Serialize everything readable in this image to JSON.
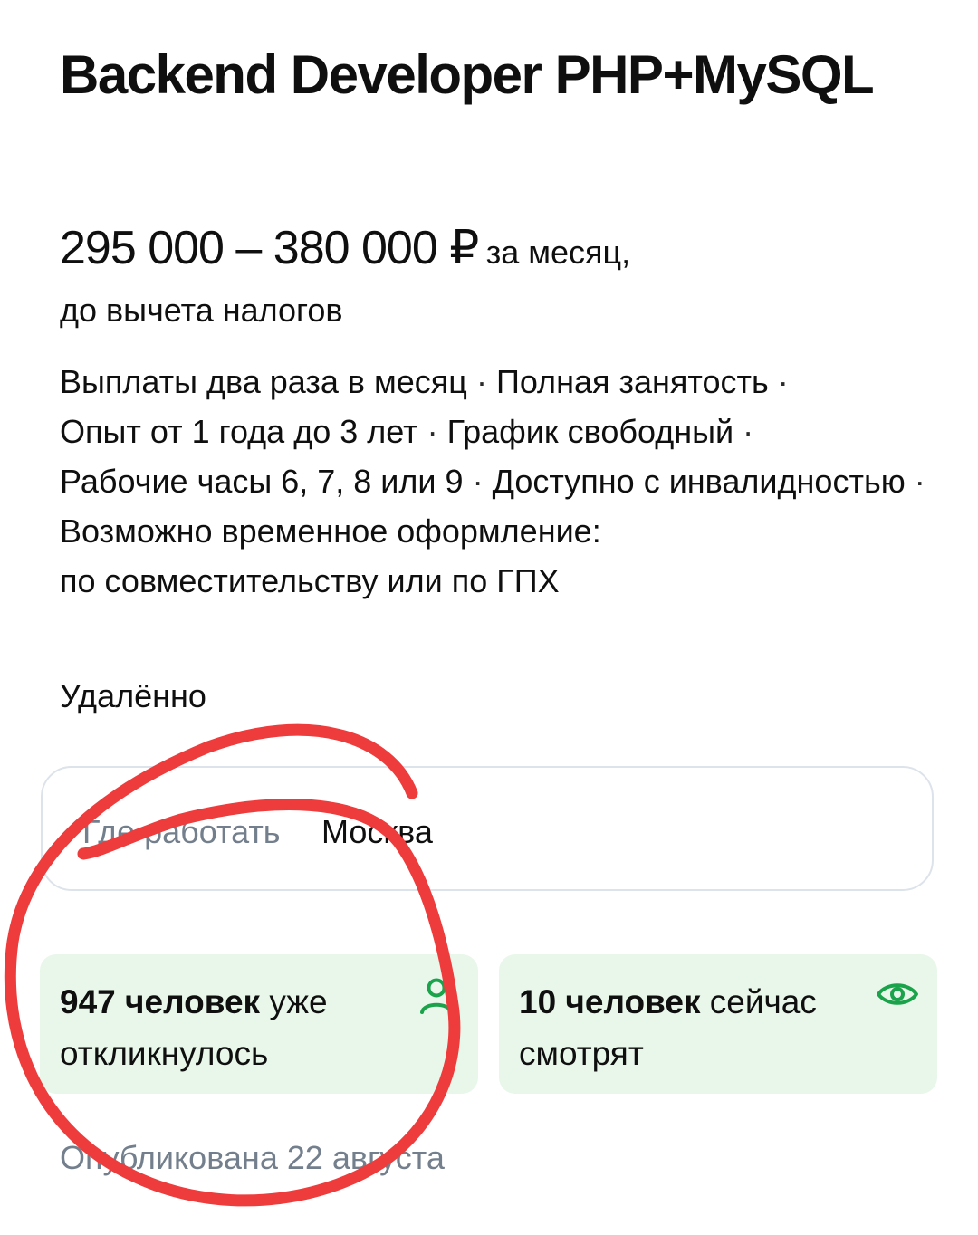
{
  "vacancy": {
    "title": "Backend Developer PHP+MySQL",
    "salary": "295 000 – 380 000 ₽",
    "salary_period": "за месяц,",
    "salary_note": "до вычета налогов",
    "conditions": [
      "Выплаты два раза в месяц",
      "Полная занятость",
      "Опыт от 1 года до 3 лет",
      "График свободный",
      "Рабочие часы 6, 7, 8 или 9",
      "Доступно с инвалидностью",
      "Возможно временное оформление:"
    ],
    "conditions_tail": "по совместительству или по ГПХ",
    "separator": "·",
    "work_format": "Удалённо",
    "location_label": "Где работать",
    "location_value": "Москва"
  },
  "stats": [
    {
      "count": "947 человек",
      "text": "уже откликнулось",
      "icon": "person-icon",
      "color": "#1aa34a"
    },
    {
      "count": "10 человек",
      "text": "сейчас смотрят",
      "icon": "eye-icon",
      "color": "#1aa34a"
    }
  ],
  "published": "Опубликована 22 августа",
  "colors": {
    "card_bg": "#e8f7ea",
    "icon_green": "#1aa34a",
    "muted_text": "#737f8c",
    "annotation_red": "#ee3b3b"
  }
}
